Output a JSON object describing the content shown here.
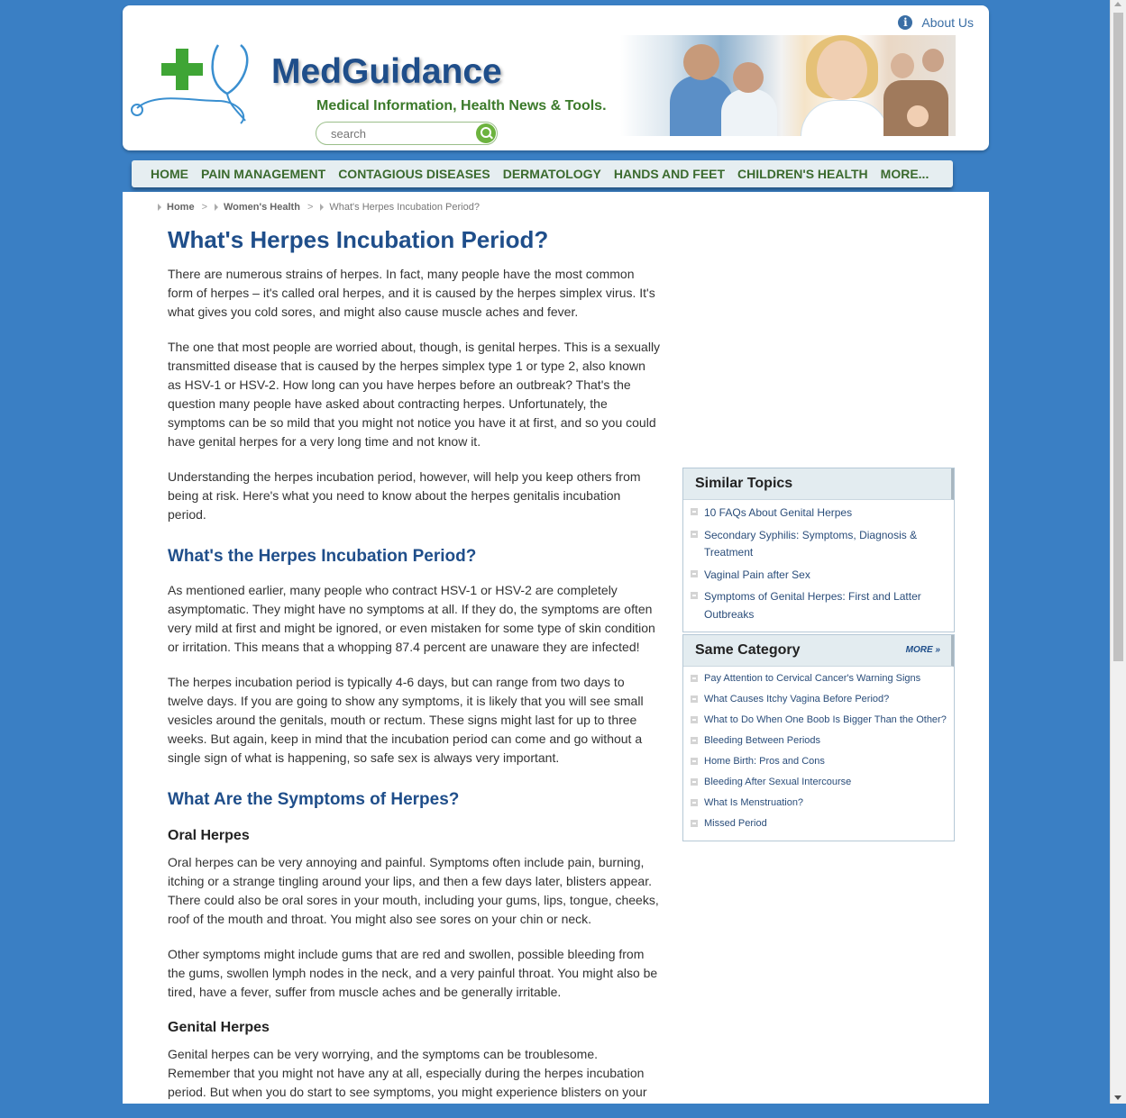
{
  "header": {
    "about_label": "About Us",
    "brand": "MedGuidance",
    "tagline": "Medical Information, Health News & Tools.",
    "search_placeholder": "search"
  },
  "nav": {
    "items": [
      "HOME",
      "PAIN MANAGEMENT",
      "CONTAGIOUS DISEASES",
      "DERMATOLOGY",
      "HANDS AND FEET",
      "CHILDREN'S HEALTH",
      "MORE..."
    ]
  },
  "breadcrumb": {
    "home": "Home",
    "category": "Women's Health",
    "current": "What's Herpes Incubation Period?",
    "separator": ">"
  },
  "article": {
    "title": "What's Herpes Incubation Period?",
    "p1": "There are numerous strains of herpes. In fact, many people have the most common form of herpes – it's called oral herpes, and it is caused by the herpes simplex virus. It's what gives you cold sores, and might also cause muscle aches and fever.",
    "p2": "The one that most people are worried about, though, is genital herpes. This is a sexually transmitted disease that is caused by the herpes simplex type 1 or type 2, also known as HSV-1 or HSV-2. How long can you have herpes before an outbreak? That's the question many people have asked about contracting herpes. Unfortunately, the symptoms can be so mild that you might not notice you have it at first, and so you could have genital herpes for a very long time and not know it.",
    "p3": "Understanding the herpes incubation period, however, will help you keep others from being at risk. Here's what you need to know about the herpes genitalis incubation period.",
    "h2a": "What's the Herpes Incubation Period?",
    "p4": "As mentioned earlier, many people who contract HSV-1 or HSV-2 are completely asymptomatic. They might have no symptoms at all. If they do, the symptoms are often very mild at first and might be ignored, or even mistaken for some type of skin condition or irritation. This means that a whopping 87.4 percent are unaware they are infected!",
    "p5": "The herpes incubation period is typically 4-6 days, but can range from two days to twelve days. If you are going to show any symptoms, it is likely that you will see small vesicles around the genitals, mouth or rectum. These signs might last for up to three weeks. But again, keep in mind that the incubation period can come and go without a single sign of what is happening, so safe sex is always very important.",
    "h2b": "What Are the Symptoms of Herpes?",
    "h3a": "Oral Herpes",
    "p6": "Oral herpes can be very annoying and painful. Symptoms often include pain, burning, itching or a strange tingling around your lips, and then a few days later, blisters appear. There could also be oral sores in your mouth, including your gums, lips, tongue, cheeks, roof of the mouth and throat. You might also see sores on your chin or neck.",
    "p7": "Other symptoms might include gums that are red and swollen, possible bleeding from the gums, swollen lymph nodes in the neck, and a very painful throat. You might also be tired, have a fever, suffer from muscle aches and be generally irritable.",
    "h3b": "Genital Herpes",
    "p8": "Genital herpes can be very worrying, and the symptoms can be troublesome. Remember that you might not have any at all, especially during the herpes incubation period. But when you do start to see symptoms, you might experience blisters on your"
  },
  "similar": {
    "title": "Similar Topics",
    "items": [
      "10 FAQs About Genital Herpes",
      "Secondary Syphilis: Symptoms, Diagnosis & Treatment",
      "Vaginal Pain after Sex",
      "Symptoms of Genital Herpes: First and Latter Outbreaks"
    ]
  },
  "same_category": {
    "title": "Same Category",
    "more_label": "MORE »",
    "items": [
      "Pay Attention to Cervical Cancer's Warning Signs",
      "What Causes Itchy Vagina Before Period?",
      "What to Do When One Boob Is Bigger Than the Other?",
      "Bleeding Between Periods",
      "Home Birth: Pros and Cons",
      "Bleeding After Sexual Intercourse",
      "What Is Menstruation?",
      "Missed Period"
    ]
  },
  "colors": {
    "page_background": "#3a7fc4",
    "brand_blue": "#1f4e8a",
    "nav_green": "#3b6a2e",
    "cross_green": "#3fa535"
  }
}
